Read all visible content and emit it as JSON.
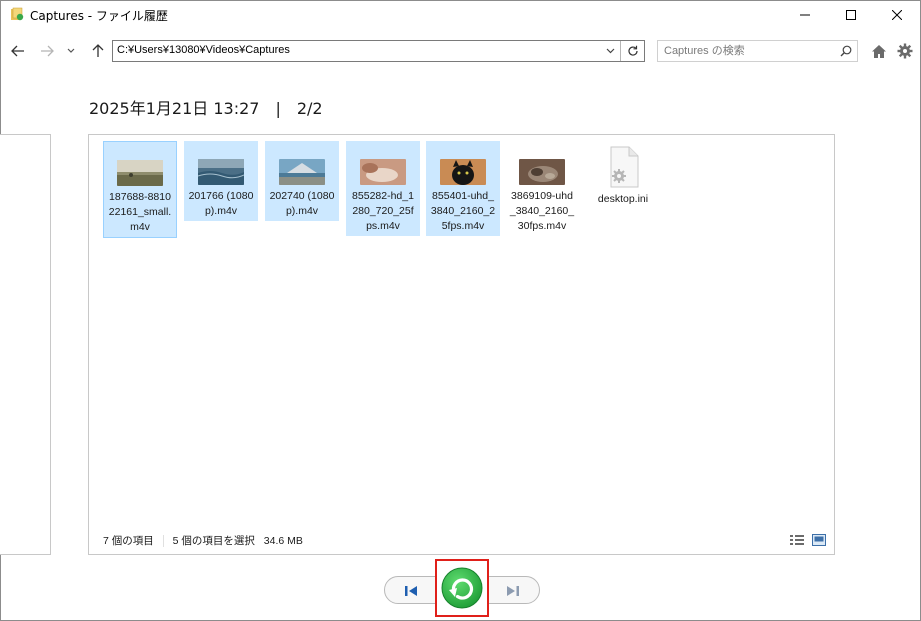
{
  "window": {
    "title": "Captures - ファイル履歴"
  },
  "nav": {
    "address": "C:¥Users¥13080¥Videos¥Captures",
    "search_placeholder": "Captures の検索"
  },
  "snapshot": {
    "heading": "2025年1月21日 13:27　|　2/2"
  },
  "files": [
    {
      "name": "187688-881022161_small.m4v",
      "selected": true,
      "focused": true,
      "thumb": "landscape-field"
    },
    {
      "name": "201766 (1080p).m4v",
      "selected": true,
      "focused": false,
      "thumb": "ocean-waves"
    },
    {
      "name": "202740 (1080p).m4v",
      "selected": true,
      "focused": false,
      "thumb": "mountain-lake"
    },
    {
      "name": "855282-hd_1280_720_25fps.m4v",
      "selected": true,
      "focused": false,
      "thumb": "sleeping-cat"
    },
    {
      "name": "855401-uhd_3840_2160_25fps.m4v",
      "selected": true,
      "focused": false,
      "thumb": "black-cat"
    },
    {
      "name": "3869109-uhd_3840_2160_30fps.m4v",
      "selected": false,
      "focused": false,
      "thumb": "tabby-cat"
    },
    {
      "name": "desktop.ini",
      "selected": false,
      "focused": false,
      "thumb": "settings-file-icon"
    }
  ],
  "status": {
    "item_count": "7 個の項目",
    "selection": "5 個の項目を選択",
    "size": "34.6 MB"
  },
  "colors": {
    "selection_bg": "#cce8ff",
    "restore_green": "#2db84a",
    "highlight_red": "#e0201a"
  }
}
